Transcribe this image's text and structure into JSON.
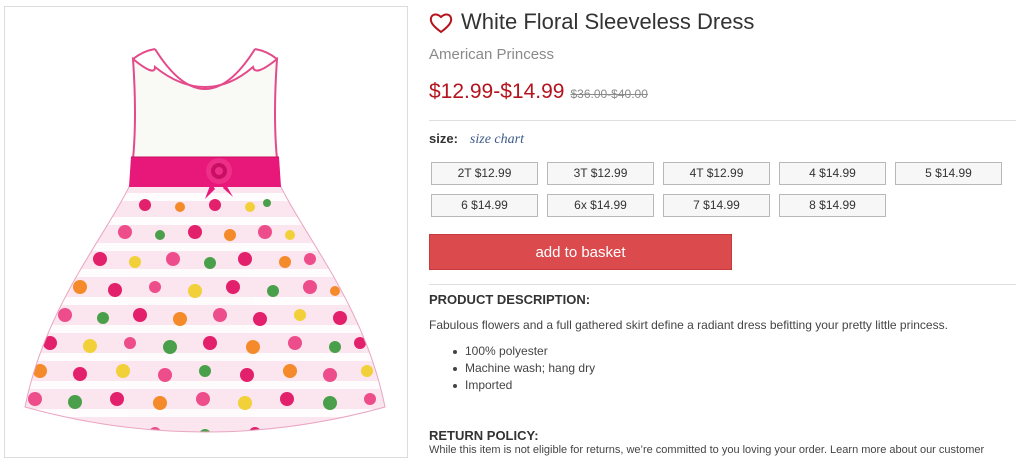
{
  "product": {
    "title": "White Floral Sleeveless Dress",
    "brand": "American Princess",
    "price": "$12.99-$14.99",
    "original_price": "$36.00-$40.00",
    "image_icon": "dress-photo",
    "favorite_icon": "heart-outline-icon",
    "colors": {
      "price": "#b3141e",
      "accent_button": "#db4b4e",
      "size_chart_link": "#3d5a8a"
    }
  },
  "size_selector": {
    "label": "size:",
    "chart_link": "size chart",
    "options": [
      {
        "label": "2T $12.99"
      },
      {
        "label": "3T $12.99"
      },
      {
        "label": "4T $12.99"
      },
      {
        "label": "4 $14.99"
      },
      {
        "label": "5 $14.99"
      },
      {
        "label": "6 $14.99"
      },
      {
        "label": "6x $14.99"
      },
      {
        "label": "7 $14.99"
      },
      {
        "label": "8 $14.99"
      }
    ]
  },
  "cta": {
    "add_to_basket": "add to basket"
  },
  "description": {
    "heading": "PRODUCT DESCRIPTION:",
    "text": "Fabulous flowers and a full gathered skirt define a radiant dress befitting your pretty little princess.",
    "features": [
      "100% polyester",
      "Machine wash; hang dry",
      "Imported"
    ]
  },
  "return_policy": {
    "heading": "RETURN POLICY:",
    "text": "While this item is not eligible for returns, we’re committed to you loving your order. Learn more about our customer"
  }
}
